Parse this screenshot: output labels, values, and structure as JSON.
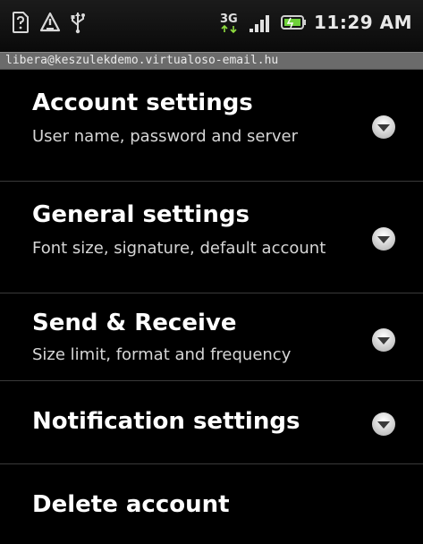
{
  "status_bar": {
    "network_label": "3G",
    "time": "11:29 AM",
    "icons": [
      "sim-card-icon",
      "alert-triangle-icon",
      "usb-icon",
      "3g-icon",
      "signal-icon",
      "battery-icon"
    ]
  },
  "account_email": "libera@keszulekdemo.virtualoso-email.hu",
  "settings": {
    "items": [
      {
        "title": "Account settings",
        "summary": "User name, password and server"
      },
      {
        "title": "General settings",
        "summary": "Font size, signature, default account"
      },
      {
        "title": "Send & Receive",
        "summary": "Size limit, format and frequency"
      },
      {
        "title": "Notification settings",
        "summary": ""
      },
      {
        "title": "Delete account",
        "summary": ""
      }
    ]
  }
}
